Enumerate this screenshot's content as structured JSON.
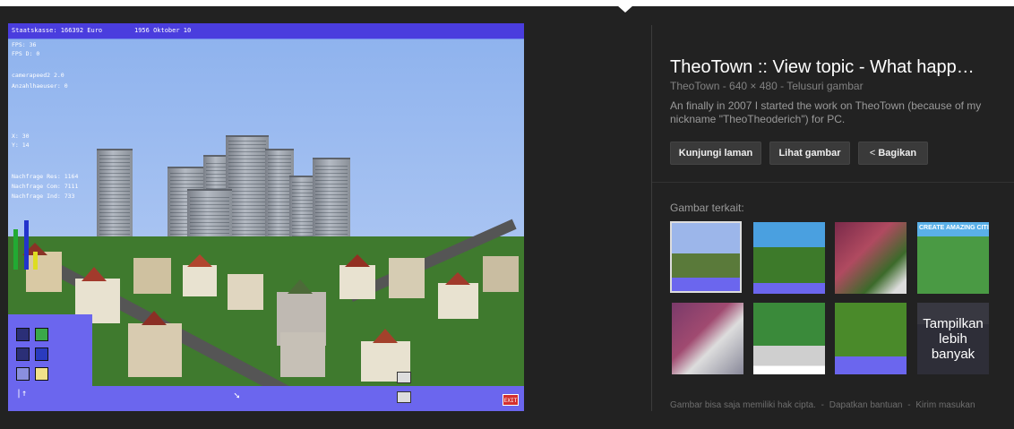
{
  "game": {
    "topbar_money": "Staatskasse: 166392 Euro",
    "topbar_date": "1956 Oktober 10",
    "debug_lines": [
      "FPS: 36",
      "FPS D: 0",
      "",
      "camerapeed2 2.0",
      "Anzahlhaeuser: 0"
    ],
    "debug_mid": [
      "X: 30",
      "Y: 14"
    ],
    "debug_demand": [
      "Nachfrage Res: 1164",
      "Nachfrage Com: 7111",
      "Nachfrage Ind: 733"
    ],
    "exit_label": "EXIT"
  },
  "info": {
    "title": "TheoTown :: View topic - What happ…",
    "meta": "TheoTown - 640 × 480 - Telusuri gambar",
    "description": "An finally in 2007 I started the work on TheoTown (because of my nickname \"TheoTheoderich\") for PC.",
    "buttons": {
      "visit": "Kunjungi laman",
      "view": "Lihat gambar",
      "share": "Bagikan"
    },
    "related_label": "Gambar terkait:",
    "more_label": "Tampilkan lebih banyak",
    "thumb3_banner": "CREATE AMAZING CITIES"
  },
  "footer": {
    "copyright": "Gambar bisa saja memiliki hak cipta.",
    "sep": "-",
    "help": "Dapatkan bantuan",
    "feedback": "Kirim masukan"
  }
}
